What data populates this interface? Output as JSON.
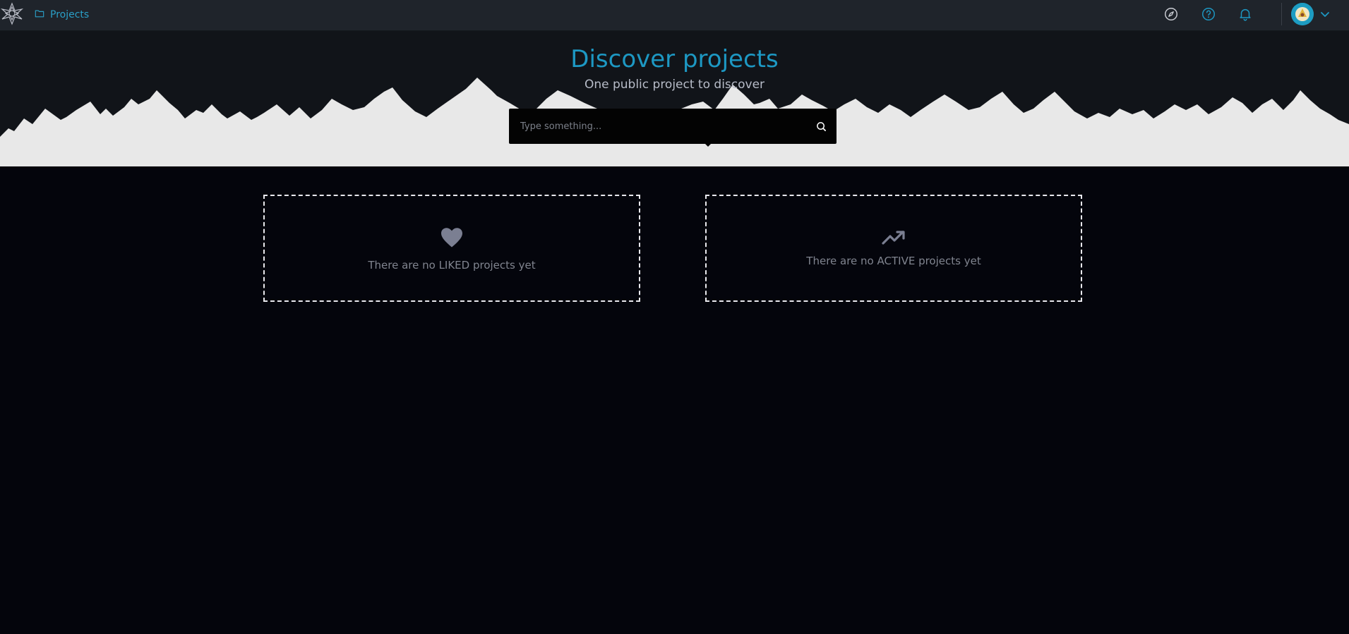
{
  "nav": {
    "breadcrumb_label": "Projects",
    "icons": [
      "compass-icon",
      "help-icon",
      "bell-icon",
      "chevron-down-icon"
    ]
  },
  "hero": {
    "title": "Discover projects",
    "subtitle": "One public project to discover"
  },
  "search": {
    "placeholder": "Type something..."
  },
  "cards": {
    "liked_text": "There are no LIKED projects yet",
    "active_text": "There are no ACTIVE projects yet"
  },
  "colors": {
    "accent": "#1d98c3",
    "topbar_bg": "#1f242b",
    "page_bg": "#04050c",
    "hero_bg": "#111419",
    "forest": "#e8e8e8",
    "muted_icon": "#7b7f92"
  }
}
